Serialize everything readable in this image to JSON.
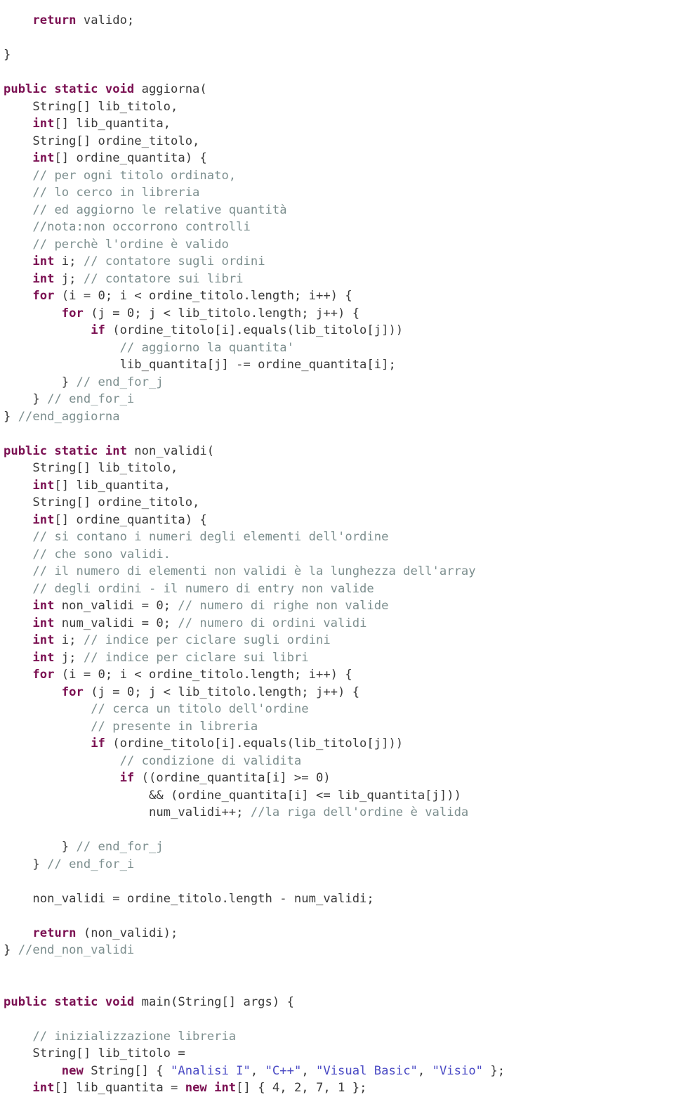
{
  "document": {
    "type": "source-code-listing",
    "language": "Java",
    "page_background": "#ffffff"
  },
  "colors": {
    "keyword": "#7b1052",
    "comment": "#7d8f8f",
    "string": "#4a4ac4",
    "plain": "#3a3a3a"
  },
  "code": {
    "lines": [
      {
        "id": 1,
        "indent": 4,
        "tokens": [
          {
            "t": "kw",
            "v": "return"
          },
          {
            "t": "pl",
            "v": " valido;"
          }
        ]
      },
      {
        "id": 2,
        "indent": 0,
        "tokens": []
      },
      {
        "id": 3,
        "indent": 0,
        "tokens": [
          {
            "t": "pl",
            "v": "}"
          }
        ]
      },
      {
        "id": 4,
        "indent": 0,
        "tokens": []
      },
      {
        "id": 5,
        "indent": 0,
        "tokens": [
          {
            "t": "kw",
            "v": "public static void"
          },
          {
            "t": "pl",
            "v": " aggiorna("
          }
        ]
      },
      {
        "id": 6,
        "indent": 4,
        "tokens": [
          {
            "t": "pl",
            "v": "String[] lib_titolo,"
          }
        ]
      },
      {
        "id": 7,
        "indent": 4,
        "tokens": [
          {
            "t": "kw",
            "v": "int"
          },
          {
            "t": "pl",
            "v": "[] lib_quantita,"
          }
        ]
      },
      {
        "id": 8,
        "indent": 4,
        "tokens": [
          {
            "t": "pl",
            "v": "String[] ordine_titolo,"
          }
        ]
      },
      {
        "id": 9,
        "indent": 4,
        "tokens": [
          {
            "t": "kw",
            "v": "int"
          },
          {
            "t": "pl",
            "v": "[] ordine_quantita) {"
          }
        ]
      },
      {
        "id": 10,
        "indent": 4,
        "tokens": [
          {
            "t": "cm",
            "v": "// per ogni titolo ordinato,"
          }
        ]
      },
      {
        "id": 11,
        "indent": 4,
        "tokens": [
          {
            "t": "cm",
            "v": "// lo cerco in libreria"
          }
        ]
      },
      {
        "id": 12,
        "indent": 4,
        "tokens": [
          {
            "t": "cm",
            "v": "// ed aggiorno le relative quantità"
          }
        ]
      },
      {
        "id": 13,
        "indent": 4,
        "tokens": [
          {
            "t": "cm",
            "v": "//nota:non occorrono controlli"
          }
        ]
      },
      {
        "id": 14,
        "indent": 4,
        "tokens": [
          {
            "t": "cm",
            "v": "// perchè l'ordine è valido"
          }
        ]
      },
      {
        "id": 15,
        "indent": 4,
        "tokens": [
          {
            "t": "kw",
            "v": "int"
          },
          {
            "t": "pl",
            "v": " i; "
          },
          {
            "t": "cm",
            "v": "// contatore sugli ordini"
          }
        ]
      },
      {
        "id": 16,
        "indent": 4,
        "tokens": [
          {
            "t": "kw",
            "v": "int"
          },
          {
            "t": "pl",
            "v": " j; "
          },
          {
            "t": "cm",
            "v": "// contatore sui libri"
          }
        ]
      },
      {
        "id": 17,
        "indent": 4,
        "tokens": [
          {
            "t": "kw",
            "v": "for"
          },
          {
            "t": "pl",
            "v": " (i = 0; i < ordine_titolo.length; i++) {"
          }
        ]
      },
      {
        "id": 18,
        "indent": 8,
        "tokens": [
          {
            "t": "kw",
            "v": "for"
          },
          {
            "t": "pl",
            "v": " (j = 0; j < lib_titolo.length; j++) {"
          }
        ]
      },
      {
        "id": 19,
        "indent": 12,
        "tokens": [
          {
            "t": "kw",
            "v": "if"
          },
          {
            "t": "pl",
            "v": " (ordine_titolo[i].equals(lib_titolo[j]))"
          }
        ]
      },
      {
        "id": 20,
        "indent": 16,
        "tokens": [
          {
            "t": "cm",
            "v": "// aggiorno la quantita'"
          }
        ]
      },
      {
        "id": 21,
        "indent": 16,
        "tokens": [
          {
            "t": "pl",
            "v": "lib_quantita[j] -= ordine_quantita[i];"
          }
        ]
      },
      {
        "id": 22,
        "indent": 8,
        "tokens": [
          {
            "t": "pl",
            "v": "} "
          },
          {
            "t": "cm",
            "v": "// end_for_j"
          }
        ]
      },
      {
        "id": 23,
        "indent": 4,
        "tokens": [
          {
            "t": "pl",
            "v": "} "
          },
          {
            "t": "cm",
            "v": "// end_for_i"
          }
        ]
      },
      {
        "id": 24,
        "indent": 0,
        "tokens": [
          {
            "t": "pl",
            "v": "} "
          },
          {
            "t": "cm",
            "v": "//end_aggiorna"
          }
        ]
      },
      {
        "id": 25,
        "indent": 0,
        "tokens": []
      },
      {
        "id": 26,
        "indent": 0,
        "tokens": [
          {
            "t": "kw",
            "v": "public static int"
          },
          {
            "t": "pl",
            "v": " non_validi("
          }
        ]
      },
      {
        "id": 27,
        "indent": 4,
        "tokens": [
          {
            "t": "pl",
            "v": "String[] lib_titolo,"
          }
        ]
      },
      {
        "id": 28,
        "indent": 4,
        "tokens": [
          {
            "t": "kw",
            "v": "int"
          },
          {
            "t": "pl",
            "v": "[] lib_quantita,"
          }
        ]
      },
      {
        "id": 29,
        "indent": 4,
        "tokens": [
          {
            "t": "pl",
            "v": "String[] ordine_titolo,"
          }
        ]
      },
      {
        "id": 30,
        "indent": 4,
        "tokens": [
          {
            "t": "kw",
            "v": "int"
          },
          {
            "t": "pl",
            "v": "[] ordine_quantita) {"
          }
        ]
      },
      {
        "id": 31,
        "indent": 4,
        "tokens": [
          {
            "t": "cm",
            "v": "// si contano i numeri degli elementi dell'ordine"
          }
        ]
      },
      {
        "id": 32,
        "indent": 4,
        "tokens": [
          {
            "t": "cm",
            "v": "// che sono validi."
          }
        ]
      },
      {
        "id": 33,
        "indent": 4,
        "tokens": [
          {
            "t": "cm",
            "v": "// il numero di elementi non validi è la lunghezza dell'array"
          }
        ]
      },
      {
        "id": 34,
        "indent": 4,
        "tokens": [
          {
            "t": "cm",
            "v": "// degli ordini - il numero di entry non valide"
          }
        ]
      },
      {
        "id": 35,
        "indent": 4,
        "tokens": [
          {
            "t": "kw",
            "v": "int"
          },
          {
            "t": "pl",
            "v": " non_validi = 0; "
          },
          {
            "t": "cm",
            "v": "// numero di righe non valide"
          }
        ]
      },
      {
        "id": 36,
        "indent": 4,
        "tokens": [
          {
            "t": "kw",
            "v": "int"
          },
          {
            "t": "pl",
            "v": " num_validi = 0; "
          },
          {
            "t": "cm",
            "v": "// numero di ordini validi"
          }
        ]
      },
      {
        "id": 37,
        "indent": 4,
        "tokens": [
          {
            "t": "kw",
            "v": "int"
          },
          {
            "t": "pl",
            "v": " i; "
          },
          {
            "t": "cm",
            "v": "// indice per ciclare sugli ordini"
          }
        ]
      },
      {
        "id": 38,
        "indent": 4,
        "tokens": [
          {
            "t": "kw",
            "v": "int"
          },
          {
            "t": "pl",
            "v": " j; "
          },
          {
            "t": "cm",
            "v": "// indice per ciclare sui libri"
          }
        ]
      },
      {
        "id": 39,
        "indent": 4,
        "tokens": [
          {
            "t": "kw",
            "v": "for"
          },
          {
            "t": "pl",
            "v": " (i = 0; i < ordine_titolo.length; i++) {"
          }
        ]
      },
      {
        "id": 40,
        "indent": 8,
        "tokens": [
          {
            "t": "kw",
            "v": "for"
          },
          {
            "t": "pl",
            "v": " (j = 0; j < lib_titolo.length; j++) {"
          }
        ]
      },
      {
        "id": 41,
        "indent": 12,
        "tokens": [
          {
            "t": "cm",
            "v": "// cerca un titolo dell'ordine"
          }
        ]
      },
      {
        "id": 42,
        "indent": 12,
        "tokens": [
          {
            "t": "cm",
            "v": "// presente in libreria"
          }
        ]
      },
      {
        "id": 43,
        "indent": 12,
        "tokens": [
          {
            "t": "kw",
            "v": "if"
          },
          {
            "t": "pl",
            "v": " (ordine_titolo[i].equals(lib_titolo[j]))"
          }
        ]
      },
      {
        "id": 44,
        "indent": 16,
        "tokens": [
          {
            "t": "cm",
            "v": "// condizione di validita"
          }
        ]
      },
      {
        "id": 45,
        "indent": 16,
        "tokens": [
          {
            "t": "kw",
            "v": "if"
          },
          {
            "t": "pl",
            "v": " ((ordine_quantita[i] >= 0)"
          }
        ]
      },
      {
        "id": 46,
        "indent": 20,
        "tokens": [
          {
            "t": "pl",
            "v": "&& (ordine_quantita[i] <= lib_quantita[j]))"
          }
        ]
      },
      {
        "id": 47,
        "indent": 20,
        "tokens": [
          {
            "t": "pl",
            "v": "num_validi++; "
          },
          {
            "t": "cm",
            "v": "//la riga dell'ordine è valida"
          }
        ]
      },
      {
        "id": 48,
        "indent": 0,
        "tokens": []
      },
      {
        "id": 49,
        "indent": 8,
        "tokens": [
          {
            "t": "pl",
            "v": "} "
          },
          {
            "t": "cm",
            "v": "// end_for_j"
          }
        ]
      },
      {
        "id": 50,
        "indent": 4,
        "tokens": [
          {
            "t": "pl",
            "v": "} "
          },
          {
            "t": "cm",
            "v": "// end_for_i"
          }
        ]
      },
      {
        "id": 51,
        "indent": 0,
        "tokens": []
      },
      {
        "id": 52,
        "indent": 4,
        "tokens": [
          {
            "t": "pl",
            "v": "non_validi = ordine_titolo.length - num_validi;"
          }
        ]
      },
      {
        "id": 53,
        "indent": 0,
        "tokens": []
      },
      {
        "id": 54,
        "indent": 4,
        "tokens": [
          {
            "t": "kw",
            "v": "return"
          },
          {
            "t": "pl",
            "v": " (non_validi);"
          }
        ]
      },
      {
        "id": 55,
        "indent": 0,
        "tokens": [
          {
            "t": "pl",
            "v": "} "
          },
          {
            "t": "cm",
            "v": "//end_non_validi"
          }
        ]
      },
      {
        "id": 56,
        "indent": 0,
        "tokens": []
      },
      {
        "id": 57,
        "indent": 0,
        "tokens": []
      },
      {
        "id": 58,
        "indent": 0,
        "tokens": [
          {
            "t": "kw",
            "v": "public static void"
          },
          {
            "t": "pl",
            "v": " main(String[] args) {"
          }
        ]
      },
      {
        "id": 59,
        "indent": 0,
        "tokens": []
      },
      {
        "id": 60,
        "indent": 4,
        "tokens": [
          {
            "t": "cm",
            "v": "// inizializzazione libreria"
          }
        ]
      },
      {
        "id": 61,
        "indent": 4,
        "tokens": [
          {
            "t": "pl",
            "v": "String[] lib_titolo ="
          }
        ]
      },
      {
        "id": 62,
        "indent": 8,
        "tokens": [
          {
            "t": "kw",
            "v": "new"
          },
          {
            "t": "pl",
            "v": " String[] { "
          },
          {
            "t": "st",
            "v": "\"Analisi I\""
          },
          {
            "t": "pl",
            "v": ", "
          },
          {
            "t": "st",
            "v": "\"C++\""
          },
          {
            "t": "pl",
            "v": ", "
          },
          {
            "t": "st",
            "v": "\"Visual Basic\""
          },
          {
            "t": "pl",
            "v": ", "
          },
          {
            "t": "st",
            "v": "\"Visio\""
          },
          {
            "t": "pl",
            "v": " };"
          }
        ]
      },
      {
        "id": 63,
        "indent": 4,
        "tokens": [
          {
            "t": "kw",
            "v": "int"
          },
          {
            "t": "pl",
            "v": "[] lib_quantita = "
          },
          {
            "t": "kw",
            "v": "new int"
          },
          {
            "t": "pl",
            "v": "[] { 4, 2, 7, 1 };"
          }
        ]
      }
    ]
  }
}
